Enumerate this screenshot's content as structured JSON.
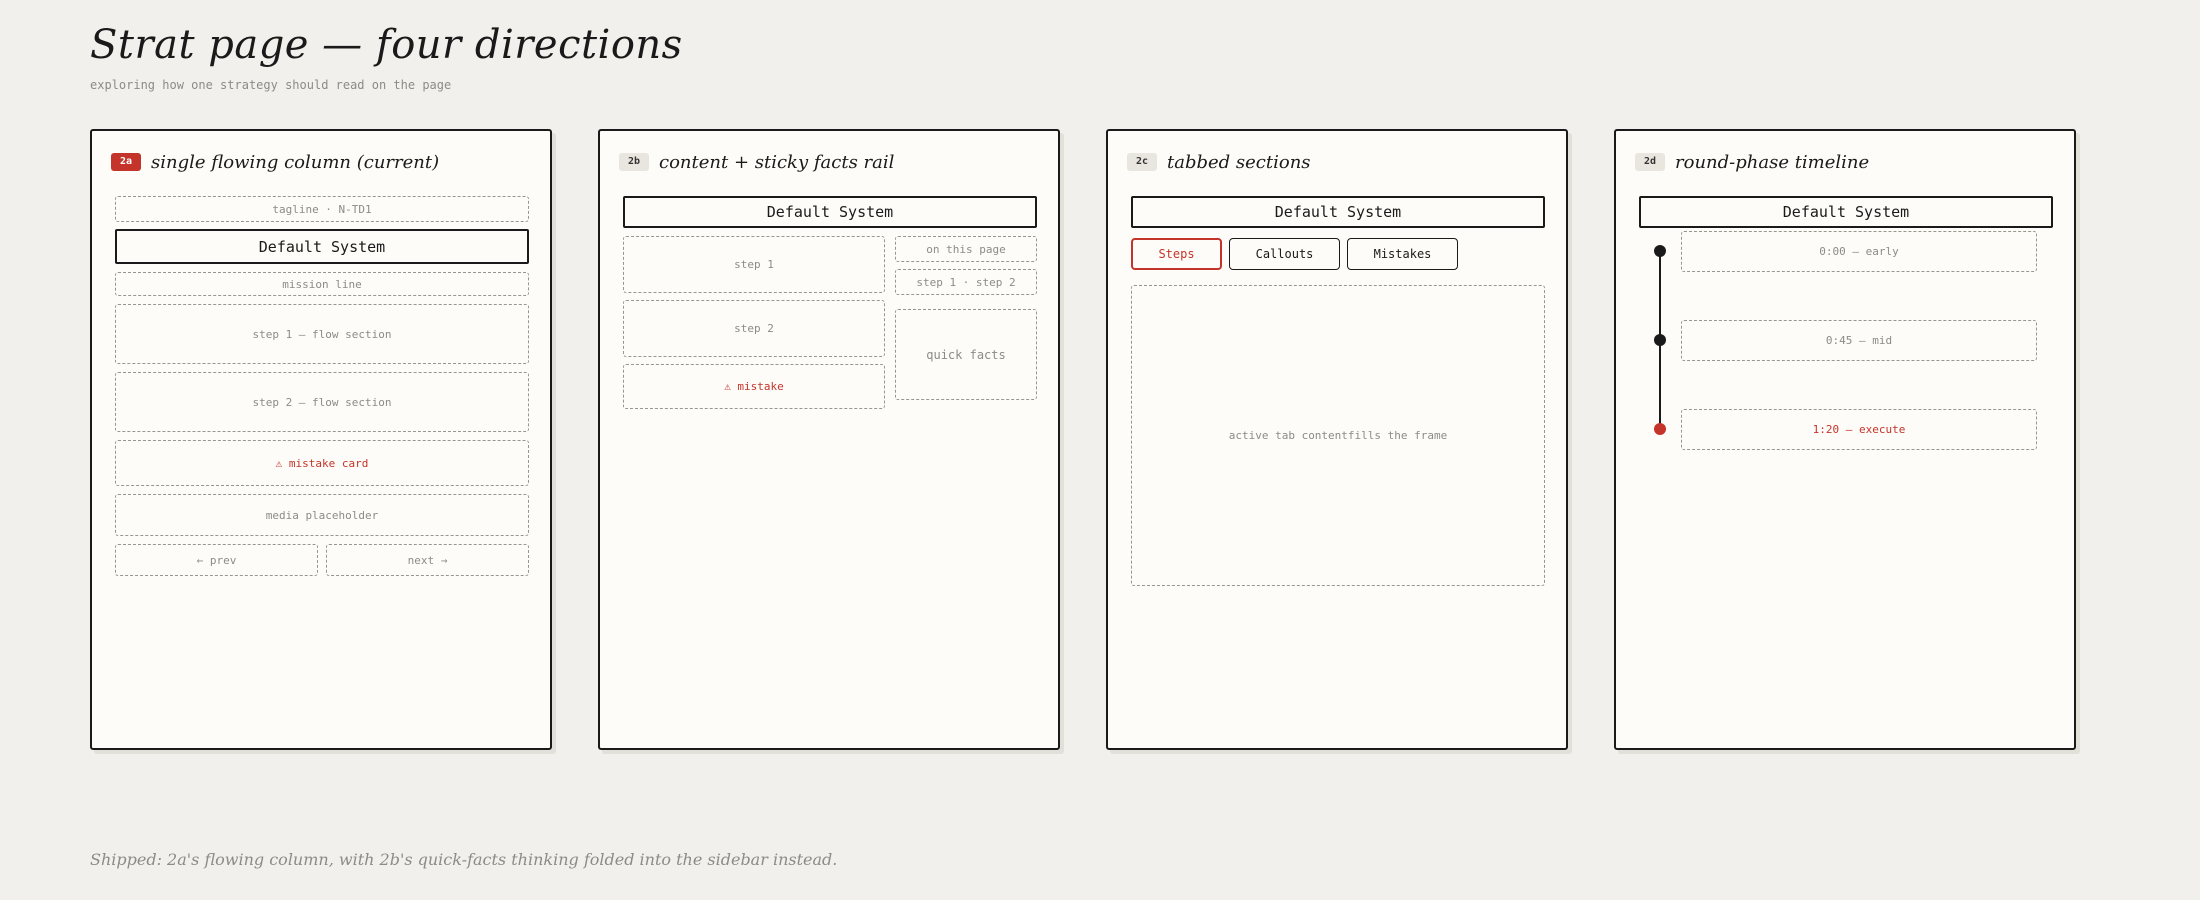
{
  "header": {
    "title": "Strat page — four directions",
    "subtitle": "exploring how one strategy should read on the page"
  },
  "cards": {
    "a": {
      "badge": "2a",
      "title": "single flowing column (current)",
      "tagline": "tagline · N-TD1",
      "system": "Default System",
      "mission": "mission line",
      "step1": "step 1 — flow section",
      "step2": "step 2 — flow section",
      "mistake": "⚠ mistake card",
      "media": "media placeholder",
      "prev": "← prev",
      "next": "next →"
    },
    "b": {
      "badge": "2b",
      "title": "content + sticky facts rail",
      "system": "Default System",
      "step1": "step 1",
      "step2": "step 2",
      "mistake": "⚠ mistake",
      "on_this_page": "on this page",
      "toc": "step 1 · step 2",
      "quick_facts": "quick facts"
    },
    "c": {
      "badge": "2c",
      "title": "tabbed sections",
      "system": "Default System",
      "tabs": [
        "Steps",
        "Callouts",
        "Mistakes"
      ],
      "content": "active tab contentfills the frame"
    },
    "d": {
      "badge": "2d",
      "title": "round-phase timeline",
      "system": "Default System",
      "phases": [
        "0:00 — early",
        "0:45 — mid",
        "1:20 — execute"
      ]
    }
  },
  "footer": "Shipped: 2a's flowing column, with 2b's quick-facts thinking folded into the sidebar instead.",
  "colors": {
    "accent": "#c4342a",
    "ink": "#1a1a1a",
    "muted": "#8d8b87",
    "page": "#f2f0ec",
    "card": "#fdfcf8"
  }
}
